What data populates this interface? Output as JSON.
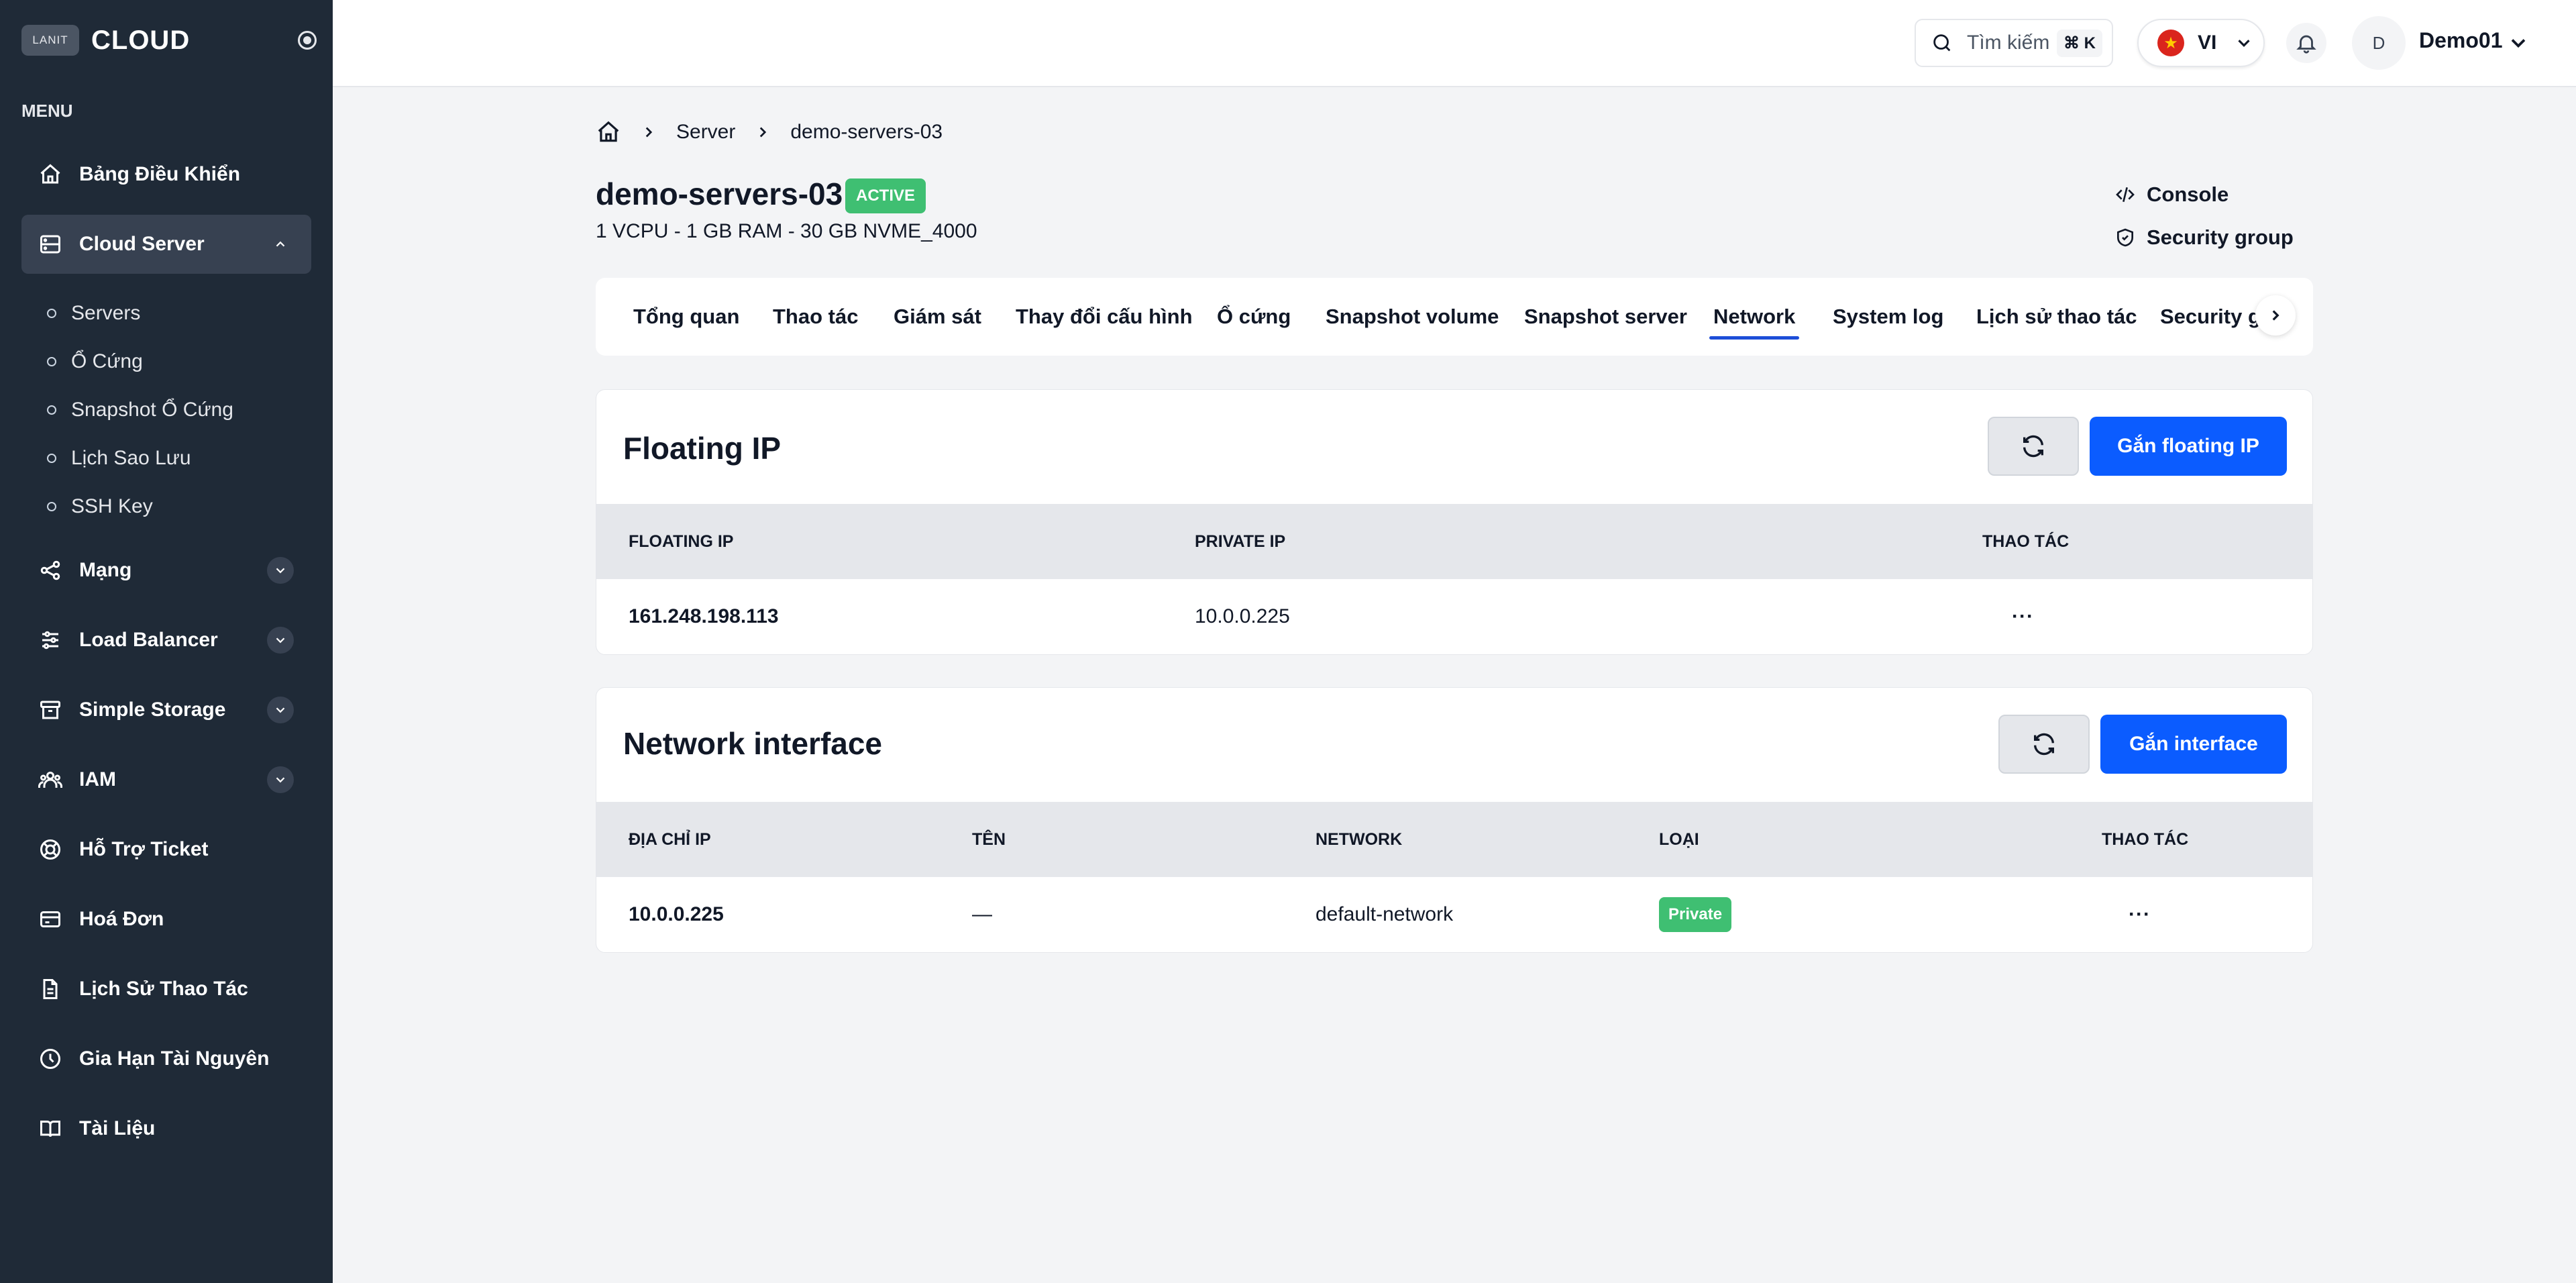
{
  "brand": {
    "badge": "LANIT",
    "name": "CLOUD"
  },
  "sidebar": {
    "menu_title": "MENU",
    "items": [
      {
        "label": "Bảng Điều Khiển",
        "icon": "home-icon"
      },
      {
        "label": "Cloud Server",
        "icon": "server-icon",
        "expanded": true
      },
      {
        "label": "Mạng",
        "icon": "share-icon"
      },
      {
        "label": "Load Balancer",
        "icon": "sliders-icon"
      },
      {
        "label": "Simple Storage",
        "icon": "archive-icon"
      },
      {
        "label": "IAM",
        "icon": "users-icon"
      },
      {
        "label": "Hỗ Trợ Ticket",
        "icon": "lifebuoy-icon"
      },
      {
        "label": "Hoá Đơn",
        "icon": "credit-card-icon"
      },
      {
        "label": "Lịch Sử Thao Tác",
        "icon": "file-icon"
      },
      {
        "label": "Gia Hạn Tài Nguyên",
        "icon": "clock-icon"
      },
      {
        "label": "Tài Liệu",
        "icon": "book-icon"
      }
    ],
    "sub_items": [
      "Servers",
      "Ổ Cứng",
      "Snapshot Ổ Cứng",
      "Lịch Sao Lưu",
      "SSH Key"
    ]
  },
  "header": {
    "search_placeholder": "Tìm kiếm",
    "search_shortcut": "⌘ K",
    "language": "VI",
    "avatar_initial": "D",
    "username": "Demo01"
  },
  "breadcrumb": {
    "items": [
      "Server",
      "demo-servers-03"
    ]
  },
  "server": {
    "name": "demo-servers-03",
    "status": "ACTIVE",
    "specs": "1 VCPU - 1 GB RAM - 30 GB NVME_4000",
    "status_color": "#3fbf72"
  },
  "actions": {
    "console": "Console",
    "security_group": "Security group"
  },
  "tabs": [
    "Tổng quan",
    "Thao tác",
    "Giám sát",
    "Thay đổi cấu hình",
    "Ổ cứng",
    "Snapshot volume",
    "Snapshot server",
    "Network",
    "System log",
    "Lịch sử thao tác",
    "Security g"
  ],
  "active_tab": "Network",
  "floating_ip": {
    "title": "Floating IP",
    "attach_label": "Gắn floating IP",
    "columns": [
      "FLOATING IP",
      "PRIVATE IP",
      "THAO TÁC"
    ],
    "rows": [
      {
        "floating_ip": "161.248.198.113",
        "private_ip": "10.0.0.225",
        "action": "···"
      }
    ]
  },
  "network_interface": {
    "title": "Network interface",
    "attach_label": "Gắn interface",
    "columns": [
      "ĐỊA CHỈ IP",
      "TÊN",
      "NETWORK",
      "LOẠI",
      "THAO TÁC"
    ],
    "rows": [
      {
        "ip": "10.0.0.225",
        "name": "—",
        "network": "default-network",
        "type": "Private",
        "action": "···"
      }
    ]
  },
  "colors": {
    "sidebar_bg": "#1f2a37",
    "primary": "#0b5cff",
    "success": "#3fbf72",
    "tab_underline": "#1d4ed8"
  }
}
